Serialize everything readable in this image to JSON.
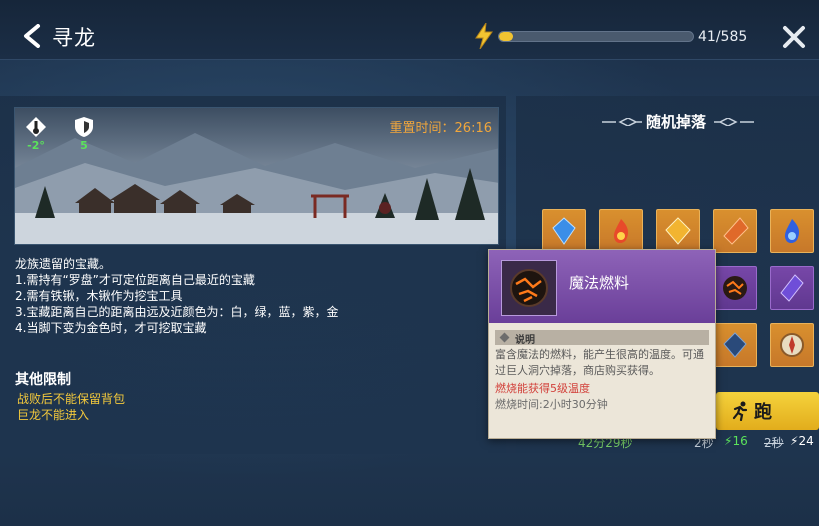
{
  "header": {
    "title": "寻龙",
    "energy_text": "41/585",
    "energy_fraction": 0.07
  },
  "scene": {
    "temperature": "-2°",
    "defense": "5",
    "reset_timer": "重置时间：26:16"
  },
  "description": {
    "lines": [
      "龙族遗留的宝藏。",
      "1.需持有“罗盘”才可定位距离自己最近的宝藏",
      "2.需有铁锹，木锹作为挖宝工具",
      "3.宝藏距离自己的距离由远及近颜色为：白，绿，蓝，紫，金",
      "4.当脚下变为金色时，才可挖取宝藏"
    ]
  },
  "limits": {
    "title": "其他限制",
    "items": [
      "战败后不能保留背包",
      "巨龙不能进入"
    ]
  },
  "drops": {
    "title": "随机掉落",
    "items": [
      {
        "name": "blue-crystal-icon",
        "color": "#3a8ee8",
        "rarity": "gold"
      },
      {
        "name": "fire-essence-icon",
        "color": "#e84a2a",
        "rarity": "gold"
      },
      {
        "name": "amber-crystal-icon",
        "color": "#e8a320",
        "rarity": "gold"
      },
      {
        "name": "orange-crystal-icon",
        "color": "#e0692a",
        "rarity": "gold"
      },
      {
        "name": "blue-fire-icon",
        "color": "#3060e0",
        "rarity": "gold"
      },
      {
        "name": "magic-fuel-icon",
        "color": "#d65a1a",
        "rarity": "purple"
      },
      {
        "name": "purple-crystal-icon",
        "color": "#6f4ed8",
        "rarity": "purple"
      },
      {
        "name": "dark-crystal-icon",
        "color": "#2a4a7a",
        "rarity": "gold"
      },
      {
        "name": "compass-icon",
        "color": "#c0a070",
        "rarity": "gold"
      }
    ]
  },
  "run_button": {
    "label": "跑"
  },
  "bottom": {
    "time_left": "42分29秒",
    "cost_a": "2秒",
    "energy_a": "16",
    "cost_b": "2秒",
    "energy_b": "24"
  },
  "tooltip": {
    "name": "魔法燃料",
    "section": "说明",
    "desc": "富含魔法的燃料，能产生很高的温度。可通过巨人洞穴掉落，商店购买获得。",
    "effect": "燃烧能获得5级温度",
    "burn_time": "燃烧时间:2小时30分钟"
  },
  "colors": {
    "accent_gold": "#f2c431",
    "timer_orange": "#f0a63c",
    "limit_yellow": "#f3c93c",
    "stat_green": "#5be35b",
    "tooltip_purple": "#7a4fa8"
  }
}
